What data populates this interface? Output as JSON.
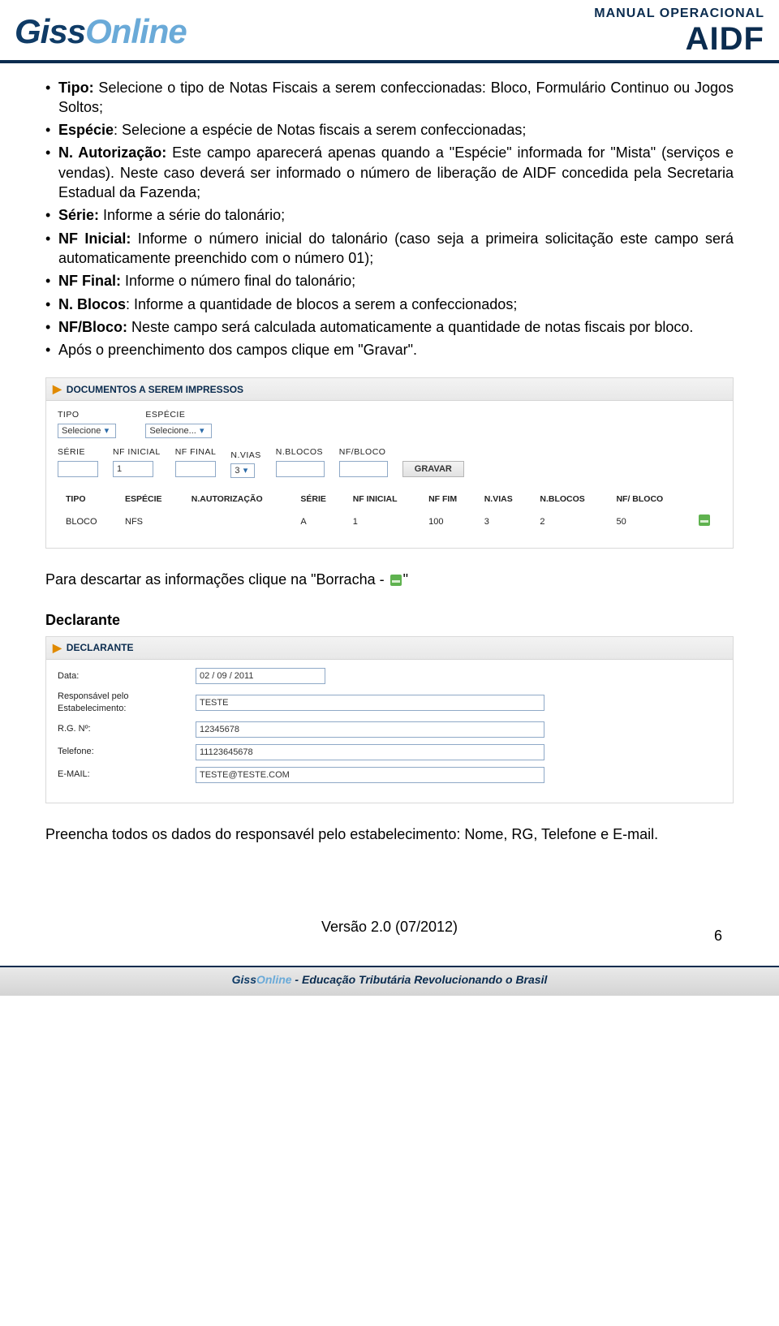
{
  "header": {
    "logo_text_left": "Giss",
    "logo_text_right": "Online",
    "manual_line1": "MANUAL OPERACIONAL",
    "manual_line2": "AIDF"
  },
  "spec_items": [
    {
      "bold_prefix": "Tipo:",
      "text": " Selecione o tipo de Notas Fiscais a serem confeccionadas: Bloco, Formulário Continuo ou Jogos Soltos;"
    },
    {
      "bold_prefix": "Espécie",
      "text": ": Selecione a espécie de Notas fiscais a serem confeccionadas;"
    },
    {
      "bold_prefix": "N. Autorização:",
      "text": " Este campo aparecerá apenas quando a \"Espécie\" informada for \"Mista\" (serviços e vendas). Neste caso deverá ser informado o número de liberação de AIDF concedida pela Secretaria Estadual da Fazenda;"
    },
    {
      "bold_prefix": "Série:",
      "text": " Informe a série do talonário;"
    },
    {
      "bold_prefix": "NF Inicial:",
      "text": " Informe o número inicial do talonário (caso seja a primeira solicitação este campo será automaticamente preenchido com o número 01);"
    },
    {
      "bold_prefix": "NF Final:",
      "text": " Informe o número final do talonário;"
    },
    {
      "bold_prefix": "N. Blocos",
      "text": ": Informe a quantidade de blocos a serem a confeccionados;"
    },
    {
      "bold_prefix": "NF/Bloco:",
      "text": " Neste campo será calculada automaticamente a quantidade de notas fiscais por bloco."
    },
    {
      "plain": "Após o preenchimento dos campos clique em \"Gravar\"."
    }
  ],
  "panel1": {
    "title": "DOCUMENTOS A SEREM IMPRESSOS",
    "labels": {
      "tipo": "TIPO",
      "especie": "ESPÉCIE",
      "serie": "SÉRIE",
      "nf_inicial": "NF INICIAL",
      "nf_final": "NF FINAL",
      "nvias": "N.VIAS",
      "nblocos": "N.BLOCOS",
      "nfbloco": "NF/BLOCO"
    },
    "values": {
      "tipo": "Selecione",
      "especie": "Selecione...",
      "serie": "",
      "nf_inicial": "1",
      "nf_final": "",
      "nvias": "3",
      "nblocos": "",
      "nfbloco": ""
    },
    "gravar_label": "GRAVAR",
    "table": {
      "headers": [
        "TIPO",
        "ESPÉCIE",
        "N.AUTORIZAÇÃO",
        "SÉRIE",
        "NF INICIAL",
        "NF FIM",
        "N.VIAS",
        "N.BLOCOS",
        "NF/ BLOCO",
        ""
      ],
      "row": [
        "BLOCO",
        "NFS",
        "",
        "A",
        "1",
        "100",
        "3",
        "2",
        "50"
      ]
    }
  },
  "discard_para_prefix": "Para descartar as informações clique na \"Borracha -",
  "discard_para_suffix": "\"",
  "declarante_heading": "Declarante",
  "panel2": {
    "title": "DECLARANTE",
    "fields": [
      {
        "label": "Data:",
        "value": "02 / 09 / 2011"
      },
      {
        "label": "Responsável pelo Estabelecimento:",
        "value": "TESTE"
      },
      {
        "label": "R.G. Nº:",
        "value": "12345678"
      },
      {
        "label": "Telefone:",
        "value": "11123645678"
      },
      {
        "label": "E-MAIL:",
        "value": "TESTE@TESTE.COM"
      }
    ]
  },
  "fill_para": "Preencha todos os dados do responsavél pelo estabelecimento:  Nome, RG, Telefone e E-mail.",
  "footer": {
    "version": "Versão 2.0 (07/2012)",
    "brand_left": "Giss",
    "brand_right": "Online",
    "tagline": " - Educação Tributária Revolucionando o Brasil",
    "page_num": "6"
  }
}
